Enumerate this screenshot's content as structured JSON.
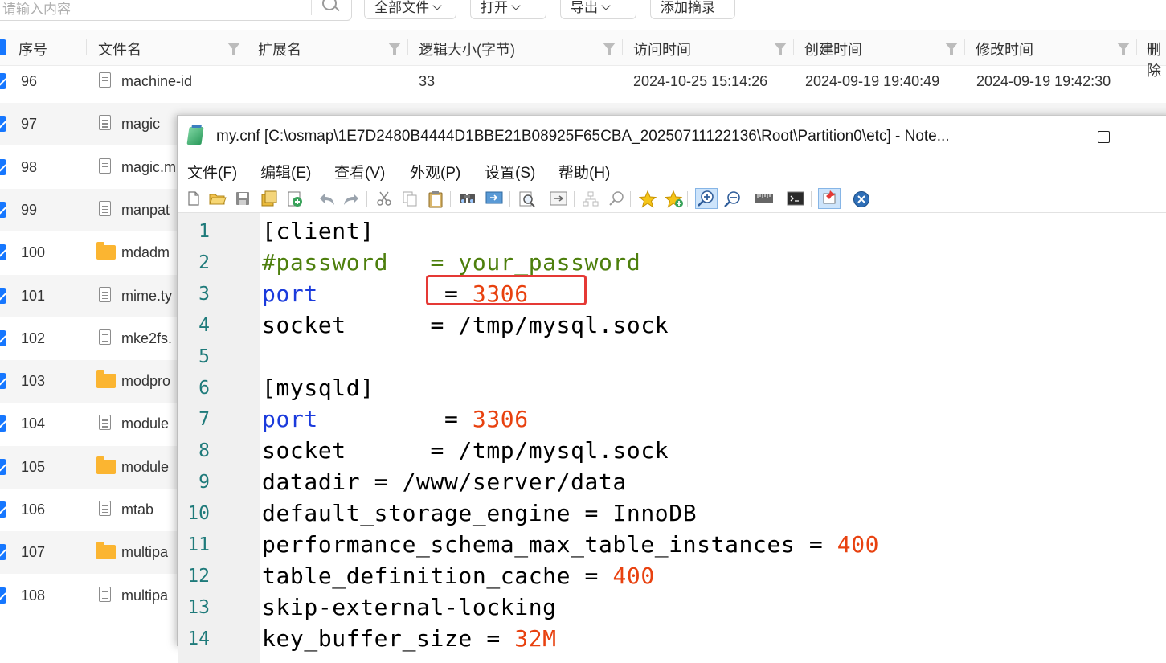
{
  "explorer": {
    "search_placeholder": "请输入内容",
    "buttons": {
      "all_files": "全部文件",
      "open": "打开",
      "export": "导出",
      "add_excerpt": "添加摘录"
    },
    "columns": {
      "index": "序号",
      "filename": "文件名",
      "extension": "扩展名",
      "logical_size": "逻辑大小(字节)",
      "access_time": "访问时间",
      "created_time": "创建时间",
      "modified_time": "修改时间",
      "deleted": "删除"
    },
    "rows": [
      {
        "index": "96",
        "name": "machine-id",
        "type": "file",
        "size": "33",
        "access": "2024-10-25 15:14:26",
        "created": "2024-09-19 19:40:49",
        "modified": "2024-09-19 19:42:30"
      },
      {
        "index": "97",
        "name": "magic",
        "type": "file"
      },
      {
        "index": "98",
        "name": "magic.m",
        "type": "file"
      },
      {
        "index": "99",
        "name": "manpat",
        "type": "file"
      },
      {
        "index": "100",
        "name": "mdadm",
        "type": "folder"
      },
      {
        "index": "101",
        "name": "mime.ty",
        "type": "file"
      },
      {
        "index": "102",
        "name": "mke2fs.",
        "type": "file"
      },
      {
        "index": "103",
        "name": "modpro",
        "type": "folder"
      },
      {
        "index": "104",
        "name": "module",
        "type": "file"
      },
      {
        "index": "105",
        "name": "module",
        "type": "folder"
      },
      {
        "index": "106",
        "name": "mtab",
        "type": "file"
      },
      {
        "index": "107",
        "name": "multipa",
        "type": "folder"
      },
      {
        "index": "108",
        "name": "multipa",
        "type": "file"
      }
    ]
  },
  "notepad": {
    "title": "my.cnf [C:\\osmap\\1E7D2480B4444D1BBE21B08925F65CBA_20250711122136\\Root\\Partition0\\etc] - Note...",
    "menu": [
      "文件(F)",
      "编辑(E)",
      "查看(V)",
      "外观(P)",
      "设置(S)",
      "帮助(H)"
    ],
    "lines": [
      {
        "n": "1",
        "parts": [
          {
            "t": "[client]",
            "c": "plain"
          }
        ]
      },
      {
        "n": "2",
        "parts": [
          {
            "t": "#password   = your_password",
            "c": "comment"
          }
        ]
      },
      {
        "n": "3",
        "parts": [
          {
            "t": "port",
            "c": "key"
          },
          {
            "t": "         = ",
            "c": "plain"
          },
          {
            "t": "3306",
            "c": "num"
          }
        ]
      },
      {
        "n": "4",
        "parts": [
          {
            "t": "socket      = /tmp/mysql.sock",
            "c": "plain"
          }
        ]
      },
      {
        "n": "5",
        "parts": []
      },
      {
        "n": "6",
        "parts": [
          {
            "t": "[mysqld]",
            "c": "plain"
          }
        ]
      },
      {
        "n": "7",
        "parts": [
          {
            "t": "port",
            "c": "key"
          },
          {
            "t": "         = ",
            "c": "plain"
          },
          {
            "t": "3306",
            "c": "num"
          }
        ]
      },
      {
        "n": "8",
        "parts": [
          {
            "t": "socket      = /tmp/mysql.sock",
            "c": "plain"
          }
        ]
      },
      {
        "n": "9",
        "parts": [
          {
            "t": "datadir = /www/server/data",
            "c": "plain"
          }
        ]
      },
      {
        "n": "10",
        "parts": [
          {
            "t": "default_storage_engine = InnoDB",
            "c": "plain"
          }
        ]
      },
      {
        "n": "11",
        "parts": [
          {
            "t": "performance_schema_max_table_instances = ",
            "c": "plain"
          },
          {
            "t": "400",
            "c": "num"
          }
        ]
      },
      {
        "n": "12",
        "parts": [
          {
            "t": "table_definition_cache = ",
            "c": "plain"
          },
          {
            "t": "400",
            "c": "num"
          }
        ]
      },
      {
        "n": "13",
        "parts": [
          {
            "t": "skip-external-locking",
            "c": "plain"
          }
        ]
      },
      {
        "n": "14",
        "parts": [
          {
            "t": "key_buffer_size = ",
            "c": "plain"
          },
          {
            "t": "32M",
            "c": "num"
          }
        ]
      }
    ],
    "colors": {
      "comment": "#4d7f0d",
      "key": "#1b3bdc",
      "number": "#e8410f",
      "line_number": "#1e7a7a",
      "highlight_box": "#e53935"
    },
    "toolbar_icons": [
      "new-file-icon",
      "open-file-icon",
      "save-icon",
      "save-all-icon",
      "reload-icon",
      "undo-icon",
      "redo-icon",
      "cut-icon",
      "copy-icon",
      "paste-icon",
      "find-icon",
      "replace-icon",
      "find-in-files-icon",
      "goto-line-icon",
      "select-icon",
      "find-next-icon",
      "favorite-icon",
      "add-favorite-icon",
      "zoom-in-icon",
      "zoom-out-icon",
      "ruler-icon",
      "terminal-icon",
      "pin-icon",
      "exit-icon"
    ]
  }
}
